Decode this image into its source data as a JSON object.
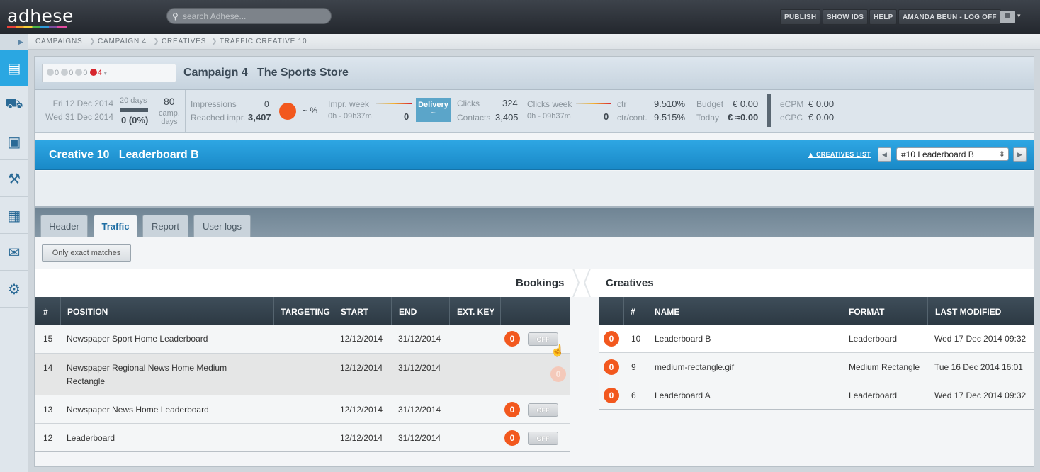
{
  "app": {
    "logo": "adhese"
  },
  "search": {
    "placeholder": "search Adhese..."
  },
  "topnav": {
    "publish": "PUBLISH",
    "show_ids": "SHOW IDS",
    "help": "HELP",
    "user": "AMANDA BEUN - LOG OFF"
  },
  "breadcrumb": [
    "CAMPAIGNS",
    "CAMPAIGN 4",
    "CREATIVES",
    "TRAFFIC CREATIVE 10"
  ],
  "sidebar": {
    "icons": [
      "campaigns-icon",
      "truck-icon",
      "briefcase-icon",
      "tools-icon",
      "calendar-icon",
      "mail-icon",
      "wrench-icon"
    ]
  },
  "campaign": {
    "status": {
      "a": "0",
      "b": "0",
      "c": "0",
      "d": "4"
    },
    "title": "Campaign 4",
    "advertiser": "The Sports Store",
    "start": "Fri 12 Dec 2014",
    "end": "Wed 31 Dec 2014",
    "days": "20 days",
    "days_progress": "0 (0%)",
    "camp_days_value": "80",
    "camp_days_label": "camp. days",
    "impressions_label": "Impressions",
    "impressions": "0",
    "reached_label": "Reached impr.",
    "reached": "3,407",
    "pct": "~ %",
    "impr_week_label": "Impr. week",
    "impr_week_time": "0h - 09h37m",
    "impr_week_value": "0",
    "delivery_label": "Delivery",
    "delivery_value": "~",
    "clicks_label": "Clicks",
    "clicks": "324",
    "contacts_label": "Contacts",
    "contacts": "3,405",
    "clicks_week_label": "Clicks week",
    "clicks_week_time": "0h - 09h37m",
    "clicks_week_value": "0",
    "ctr_label": "ctr",
    "ctr": "9.510%",
    "ctr_cont_label": "ctr/cont.",
    "ctr_cont": "9.515%",
    "budget_label": "Budget",
    "budget": "€ 0.00",
    "today_label": "Today",
    "today": "€ ≈0.00",
    "ecpm_label": "eCPM",
    "ecpm": "€ 0.00",
    "ecpc_label": "eCPC",
    "ecpc": "€ 0.00"
  },
  "creative": {
    "title": "Creative 10",
    "name": "Leaderboard B",
    "list_link": "▲ CREATIVES LIST",
    "selected": "#10 Leaderboard B"
  },
  "tabs": [
    "Header",
    "Traffic",
    "Report",
    "User logs"
  ],
  "filter": {
    "exact": "Only exact matches"
  },
  "sections": {
    "bookings": "Bookings",
    "creatives": "Creatives"
  },
  "bookings": {
    "headers": [
      "#",
      "POSITION",
      "TARGETING",
      "START",
      "END",
      "EXT. KEY"
    ],
    "rows": [
      {
        "id": "15",
        "position": "Newspaper Sport Home Leaderboard",
        "start": "12/12/2014",
        "end": "31/12/2014",
        "count": "0",
        "toggle": "OFF"
      },
      {
        "id": "14",
        "position": "Newspaper Regional News Home Medium",
        "position2": "Rectangle",
        "start": "12/12/2014",
        "end": "31/12/2014",
        "count": "0"
      },
      {
        "id": "13",
        "position": "Newspaper News Home Leaderboard",
        "start": "12/12/2014",
        "end": "31/12/2014",
        "count": "0",
        "toggle": "OFF"
      },
      {
        "id": "12",
        "position": "Leaderboard",
        "start": "12/12/2014",
        "end": "31/12/2014",
        "count": "0",
        "toggle": "OFF"
      }
    ]
  },
  "creatives": {
    "headers": [
      "#",
      "NAME",
      "FORMAT",
      "LAST MODIFIED"
    ],
    "rows": [
      {
        "count": "0",
        "id": "10",
        "name": "Leaderboard B",
        "format": "Leaderboard",
        "modified": "Wed 17 Dec 2014 09:32"
      },
      {
        "count": "0",
        "id": "9",
        "name": "medium-rectangle.gif",
        "format": "Medium Rectangle",
        "modified": "Tue 16 Dec 2014 16:01"
      },
      {
        "count": "0",
        "id": "6",
        "name": "Leaderboard A",
        "format": "Leaderboard",
        "modified": "Wed 17 Dec 2014 09:32"
      }
    ]
  }
}
